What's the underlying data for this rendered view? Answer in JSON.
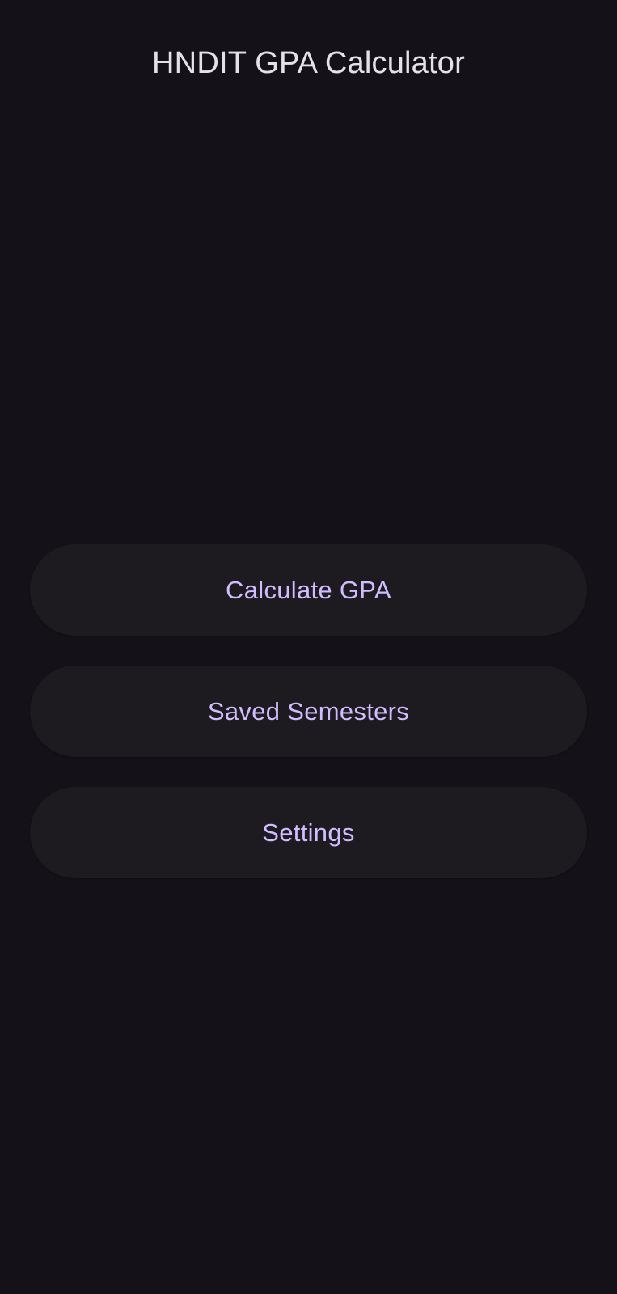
{
  "app_bar": {
    "title": "HNDIT GPA Calculator"
  },
  "menu": {
    "calculate_label": "Calculate GPA",
    "saved_label": "Saved Semesters",
    "settings_label": "Settings"
  },
  "colors": {
    "background": "#141218",
    "button_surface": "#1D1B20",
    "accent_text": "#D0BCFF",
    "title_text": "#E6E0E9"
  }
}
